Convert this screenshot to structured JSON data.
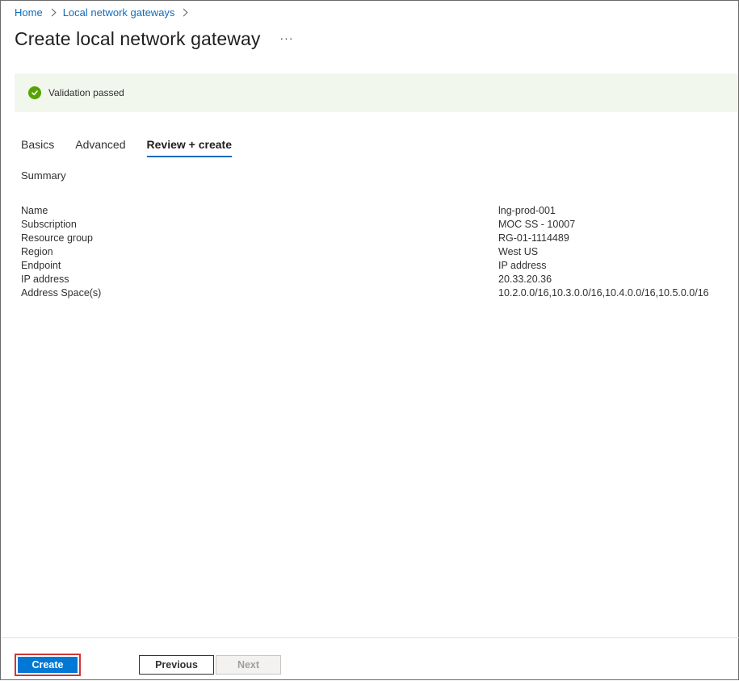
{
  "breadcrumb": {
    "items": [
      "Home",
      "Local network gateways"
    ]
  },
  "page": {
    "title": "Create local network gateway",
    "more_label": "···"
  },
  "validation": {
    "message": "Validation passed",
    "color": "#57a300"
  },
  "tabs": [
    {
      "label": "Basics",
      "active": false
    },
    {
      "label": "Advanced",
      "active": false
    },
    {
      "label": "Review + create",
      "active": true
    }
  ],
  "summary": {
    "heading": "Summary",
    "rows": [
      {
        "key": "Name",
        "value": "lng-prod-001"
      },
      {
        "key": "Subscription",
        "value": "MOC SS - 10007"
      },
      {
        "key": "Resource group",
        "value": "RG-01-1114489"
      },
      {
        "key": "Region",
        "value": "West US"
      },
      {
        "key": "Endpoint",
        "value": "IP address"
      },
      {
        "key": "IP address",
        "value": "20.33.20.36"
      },
      {
        "key": "Address Space(s)",
        "value": "10.2.0.0/16,10.3.0.0/16,10.4.0.0/16,10.5.0.0/16"
      }
    ]
  },
  "footer": {
    "create_label": "Create",
    "previous_label": "Previous",
    "next_label": "Next"
  },
  "colors": {
    "accent": "#0078d4",
    "link": "#0f6cbd",
    "highlight_border": "#d13438"
  }
}
